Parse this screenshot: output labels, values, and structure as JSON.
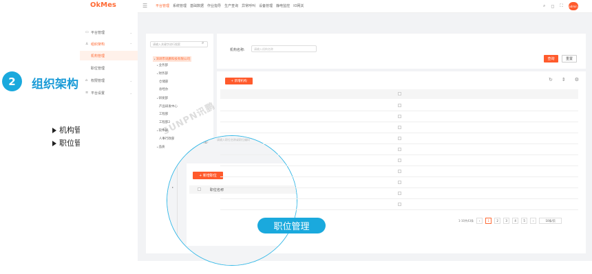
{
  "annotation": {
    "step_number": "2",
    "step_title": "组织架构",
    "bullets": [
      "机构管理",
      "职位管理"
    ]
  },
  "app": {
    "logo": "OkMes",
    "nav": [
      "平台管理",
      "系统管理",
      "基础数据",
      "作业指导",
      "生产查询",
      "异常呼叫",
      "设备管理",
      "静电监控",
      "IO网关"
    ],
    "nav_active_index": 0,
    "avatar_text": "admin",
    "accent_color": "#ff5a2c"
  },
  "sidebar": {
    "items": [
      {
        "icon": "monitor-icon",
        "label": "平台管理",
        "type": "group"
      },
      {
        "icon": "org-icon",
        "label": "组织架构",
        "type": "group-open"
      },
      {
        "icon": "",
        "label": "机构管理",
        "type": "active"
      },
      {
        "icon": "",
        "label": "职位管理",
        "type": "sub"
      },
      {
        "icon": "lock-icon",
        "label": "权限管理",
        "type": "group"
      },
      {
        "icon": "sliders-icon",
        "label": "平台设置",
        "type": "group"
      }
    ]
  },
  "tree": {
    "search_placeholder": "请输入关键字进行搜索",
    "nodes": [
      {
        "label": "深圳市讯鹏科技有限公司",
        "level": 0,
        "caret": true,
        "selected": true
      },
      {
        "label": "业务部",
        "level": 1,
        "caret": true
      },
      {
        "label": "财务部",
        "level": 1,
        "caret": true
      },
      {
        "label": "仓储部",
        "level": 1,
        "caret": false
      },
      {
        "label": "总经办",
        "level": 1,
        "caret": false
      },
      {
        "label": "研发部",
        "level": 1,
        "caret": true
      },
      {
        "label": "产品研发中心",
        "level": 1,
        "caret": false
      },
      {
        "label": "工程部",
        "level": 1,
        "caret": false
      },
      {
        "label": "工程部2",
        "level": 1,
        "caret": false
      },
      {
        "label": "软件部",
        "level": 1,
        "caret": true
      },
      {
        "label": "人事行政部",
        "level": 1,
        "caret": false
      },
      {
        "label": "品质",
        "level": 1,
        "caret": true
      }
    ]
  },
  "filter": {
    "label": "机构名称:",
    "placeholder": "请输入机构名称",
    "query_button": "查询",
    "reset_button": "重置"
  },
  "table": {
    "add_button": "+ 新增机构",
    "rows": 10
  },
  "pagination": {
    "summary": "1-10共43条",
    "pages": [
      "1",
      "2",
      "3",
      "4",
      "5"
    ],
    "active_page": "1",
    "page_size": "10条/页"
  },
  "magnifier": {
    "form_label": "职位:",
    "form_placeholder": "请输入职位名称或职位编码",
    "add_button": "+ 新增职位",
    "column": "职位名称"
  },
  "watermark": "SUNPN讯鹏",
  "callout": "职位管理"
}
